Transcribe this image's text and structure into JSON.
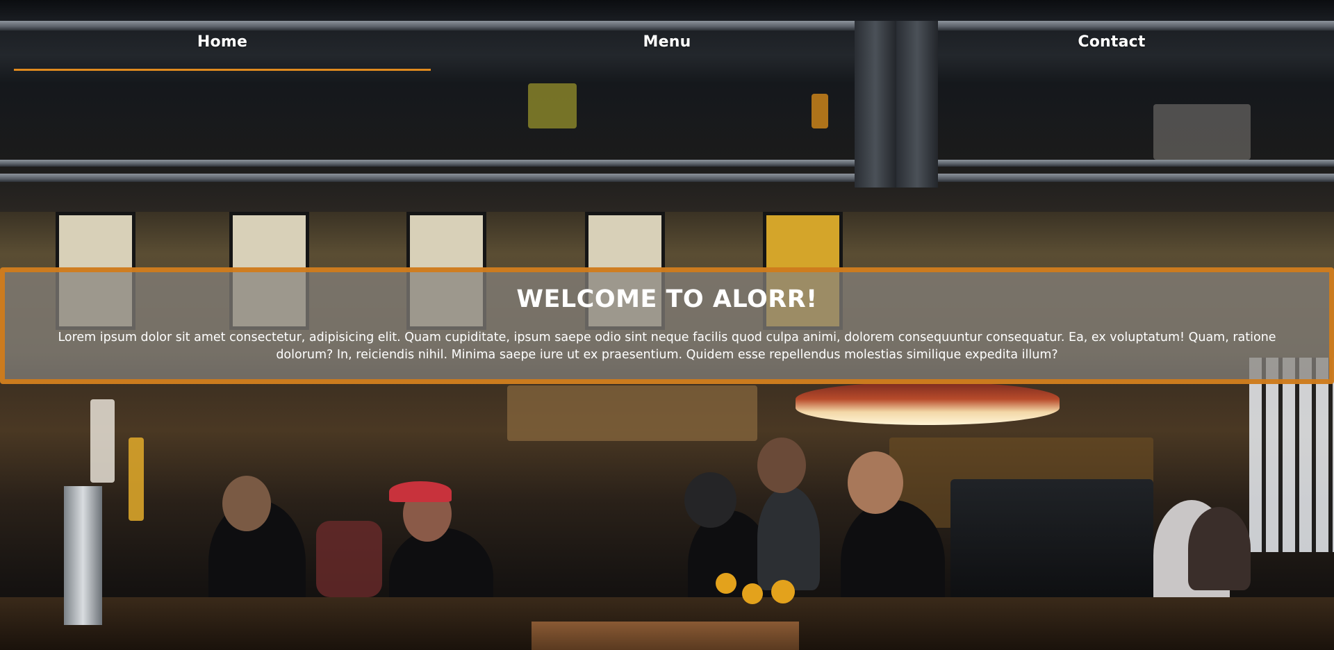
{
  "colors": {
    "accent": "#e08a1e",
    "banner_border": "#d47d19",
    "banner_fill": "#87827d",
    "nav_text": "#ffffff"
  },
  "nav": {
    "items": [
      {
        "label": "Home",
        "active": true
      },
      {
        "label": "Menu",
        "active": false
      },
      {
        "label": "Contact",
        "active": false
      }
    ]
  },
  "banner": {
    "title": "WELCOME TO ALORR!",
    "text": "Lorem ipsum dolor sit amet consectetur, adipisicing elit. Quam cupiditate, ipsum saepe odio sint neque facilis quod culpa animi, dolorem consequuntur consequatur. Ea, ex voluptatum! Quam, ratione dolorum? In, reiciendis nihil. Minima saepe iure ut ex praesentium. Quidem esse repellendus molestias similique expedita illum?"
  },
  "background": {
    "description_icon": "restaurant-bar-photo"
  }
}
